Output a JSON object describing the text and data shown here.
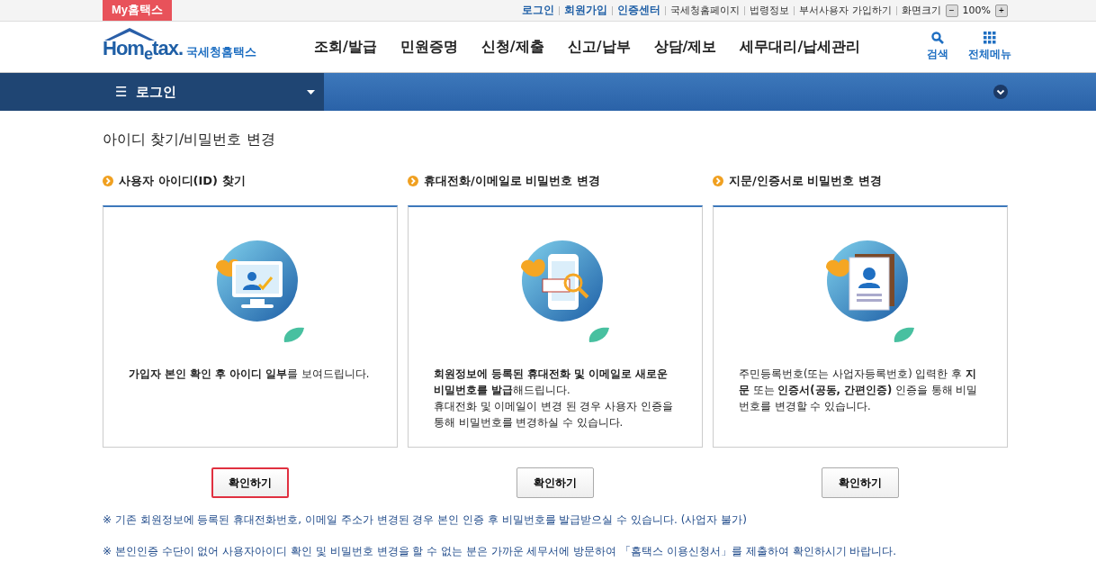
{
  "top_bar": {
    "my_button": "My홈택스",
    "links": [
      {
        "label": "로그인",
        "kind": "primary"
      },
      {
        "label": "회원가입",
        "kind": "primary"
      },
      {
        "label": "인증센터",
        "kind": "primary"
      },
      {
        "label": "국세청홈페이지",
        "kind": "plain"
      },
      {
        "label": "법령정보",
        "kind": "plain"
      },
      {
        "label": "부서사용자 가입하기",
        "kind": "plain"
      }
    ],
    "zoom_label": "화면크기",
    "zoom_minus": "−",
    "zoom_value": "100%",
    "zoom_plus": "+"
  },
  "header": {
    "logo_text": "Hom$_{e}$tax.",
    "logo_sub": "국세청홈택스",
    "nav": [
      "조회/발급",
      "민원증명",
      "신청/제출",
      "신고/납부",
      "상담/제보",
      "세무대리/납세관리"
    ],
    "search": "검색",
    "all_menu": "전체메뉴"
  },
  "location_bar": {
    "menu_icon": "☰",
    "label": "로그인"
  },
  "page_title": "아이디 찾기/비밀번호 변경",
  "options": [
    {
      "heading": "사용자 아이디(ID) 찾기",
      "kind": "monitor",
      "lines": [
        "**가입자 본인 확인 후 아이디 일부**를 보여드립니다."
      ],
      "button": "확인하기",
      "highlighted": true
    },
    {
      "heading": "휴대전화/이메일로 비밀번호 변경",
      "kind": "phone",
      "lines": [
        "**회원정보에 등록된 휴대전화 및 이메일로 새로운 비밀번호를 발급**해드립니다.",
        "휴대전화 및 이메일이 변경 된 경우 사용자 인증을 통해 비밀번호를 변경하실 수 있습니다."
      ],
      "button": "확인하기",
      "highlighted": false
    },
    {
      "heading": "지문/인증서로 비밀번호 변경",
      "kind": "certificate",
      "lines": [
        "주민등록번호(또는 사업자등록번호) 입력한 후 **지문** 또는 **인증서(공동, 간편인증)** 인증을 통해 비밀번호를 변경할 수 있습니다."
      ],
      "button": "확인하기",
      "highlighted": false
    }
  ],
  "notes": [
    "※ 기존 회원정보에 등록된 휴대전화번호, 이메일 주소가 변경된 경우 본인 인증 후 비밀번호를 발급받으실 수 있습니다. (사업자 불가)",
    "※ 본인인증 수단이 없어 사용자아이디 확인 및 비밀번호 변경을 할 수 없는 분은 가까운 세무서에 방문하여 「홈택스 이용신청서」를 제출하여 확인하시기 바랍니다."
  ]
}
